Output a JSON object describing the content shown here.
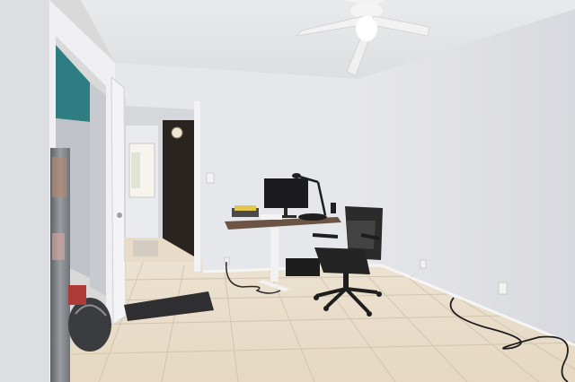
{
  "photo": {
    "watermark_text": "",
    "colors": {
      "ceiling": "#e4e5e7",
      "left_wall": "#dcdee2",
      "back_wall": "#e7e8ec",
      "right_wall": "#e3e4e8",
      "floor": "#e9dcc8",
      "grout": "#cbbfa9",
      "teal_wall": "#2d7d82",
      "dark_door": "#2a2320",
      "desk_top": "#6b5443",
      "desk_legs": "#f2f2f2",
      "chair": "#2b2b2b",
      "monitor": "#1b1b1d",
      "fan": "#f4f4f4",
      "mat": "#2f2f31",
      "fridge": "#8c8f94"
    },
    "objects": [
      "ceiling-fan",
      "standing-desk",
      "monitor",
      "desk-lamp",
      "office-chair",
      "closet-doorway",
      "refrigerator",
      "floor-mat",
      "hallway-door",
      "power-cables",
      "tile-floor"
    ]
  }
}
